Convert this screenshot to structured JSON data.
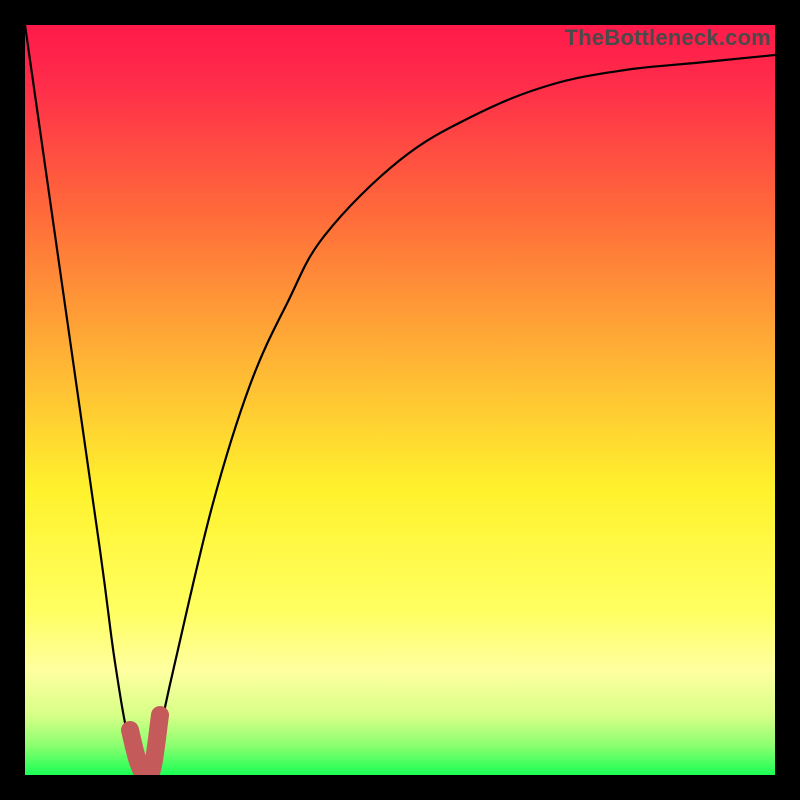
{
  "watermark": "TheBottleneck.com",
  "chart_data": {
    "type": "line",
    "title": "",
    "xlabel": "",
    "ylabel": "",
    "xlim": [
      0,
      100
    ],
    "ylim": [
      0,
      100
    ],
    "series": [
      {
        "name": "bottleneck-curve",
        "x": [
          0,
          5,
          10,
          12,
          14,
          16,
          17,
          18,
          20,
          25,
          30,
          35,
          40,
          50,
          60,
          70,
          80,
          90,
          100
        ],
        "values": [
          100,
          65,
          30,
          15,
          4,
          0,
          2,
          6,
          15,
          36,
          52,
          63,
          72,
          82,
          88,
          92,
          94,
          95,
          96
        ]
      },
      {
        "name": "highlight-segment",
        "x": [
          14,
          15,
          16,
          17,
          18
        ],
        "values": [
          6,
          2,
          0,
          1,
          8
        ]
      }
    ],
    "gradient_stops": [
      {
        "offset": 0.0,
        "color": "#ff1a4a"
      },
      {
        "offset": 0.08,
        "color": "#ff2d4a"
      },
      {
        "offset": 0.25,
        "color": "#ff6a3a"
      },
      {
        "offset": 0.45,
        "color": "#ffb535"
      },
      {
        "offset": 0.62,
        "color": "#fff22d"
      },
      {
        "offset": 0.78,
        "color": "#ffff60"
      },
      {
        "offset": 0.86,
        "color": "#ffffa0"
      },
      {
        "offset": 0.92,
        "color": "#d8ff88"
      },
      {
        "offset": 0.96,
        "color": "#8dff70"
      },
      {
        "offset": 1.0,
        "color": "#1aff55"
      }
    ],
    "colors": {
      "curve": "#000000",
      "highlight": "#c45a5a",
      "frame": "#000000"
    }
  }
}
